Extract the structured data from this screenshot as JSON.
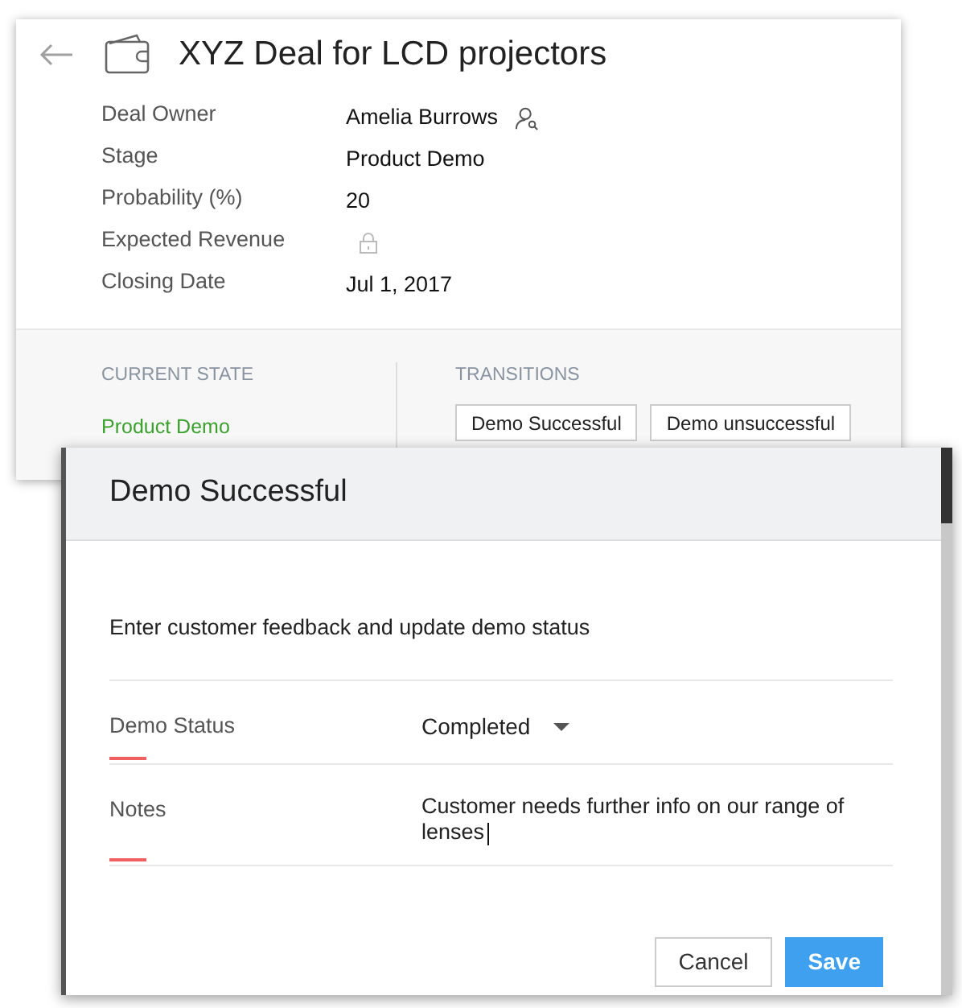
{
  "record": {
    "title": "XYZ Deal for LCD projectors",
    "fields": [
      {
        "label": "Deal Owner",
        "value": "Amelia Burrows",
        "kind": "user"
      },
      {
        "label": "Stage",
        "value": "Product Demo",
        "kind": "text"
      },
      {
        "label": "Probability (%)",
        "value": "20",
        "kind": "text"
      },
      {
        "label": "Expected Revenue",
        "kind": "locked"
      },
      {
        "label": "Closing Date",
        "value": "Jul 1, 2017",
        "kind": "text"
      }
    ],
    "current_state": {
      "heading": "CURRENT STATE",
      "value": "Product Demo"
    },
    "transitions": {
      "heading": "TRANSITIONS",
      "buttons": [
        "Demo Successful",
        "Demo unsuccessful"
      ]
    }
  },
  "dialog": {
    "title": "Demo Successful",
    "description": "Enter customer feedback and update demo status",
    "fields": [
      {
        "label": "Demo Status",
        "value": "Completed",
        "kind": "select",
        "focused": false
      },
      {
        "label": "Notes",
        "value": "Customer needs further info on our range of lenses",
        "kind": "textarea",
        "focused": true
      }
    ],
    "buttons": [
      {
        "label": "Cancel",
        "kind": "secondary"
      },
      {
        "label": "Save",
        "kind": "primary"
      }
    ]
  }
}
